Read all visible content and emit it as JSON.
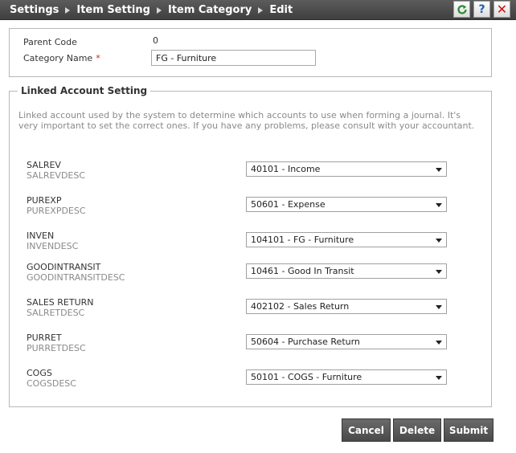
{
  "breadcrumb": [
    "Settings",
    "Item Setting",
    "Item Category",
    "Edit"
  ],
  "toolbar": {
    "refresh_icon": "refresh-icon",
    "help_icon": "help-icon",
    "help_glyph": "?",
    "close_icon": "close-icon",
    "close_glyph": "✕"
  },
  "form": {
    "parent_code_label": "Parent Code",
    "parent_code_value": "0",
    "category_name_label": "Category Name",
    "required_mark": "*",
    "category_name_value": "FG - Furniture"
  },
  "linked": {
    "legend": "Linked Account Setting",
    "note": "Linked account used by the system to determine which accounts to use when forming a journal. It's very important to set the correct ones. If you have any problems, please consult with your accountant.",
    "accounts": [
      {
        "code": "SALREV",
        "desc": "SALREVDESC",
        "value": "40101 - Income"
      },
      {
        "code": "PUREXP",
        "desc": "PUREXPDESC",
        "value": "50601 - Expense"
      },
      {
        "code": "INVEN",
        "desc": "INVENDESC",
        "value": "104101 - FG - Furniture"
      },
      {
        "code": "GOODINTRANSIT",
        "desc": "GOODINTRANSITDESC",
        "value": "10461 - Good In Transit"
      },
      {
        "code": "SALES RETURN",
        "desc": "SALRETDESC",
        "value": "402102 - Sales Return"
      },
      {
        "code": "PURRET",
        "desc": "PURRETDESC",
        "value": "50604 - Purchase Return"
      },
      {
        "code": "COGS",
        "desc": "COGSDESC",
        "value": "50101 - COGS - Furniture"
      }
    ]
  },
  "actions": {
    "cancel": "Cancel",
    "delete": "Delete",
    "submit": "Submit"
  }
}
